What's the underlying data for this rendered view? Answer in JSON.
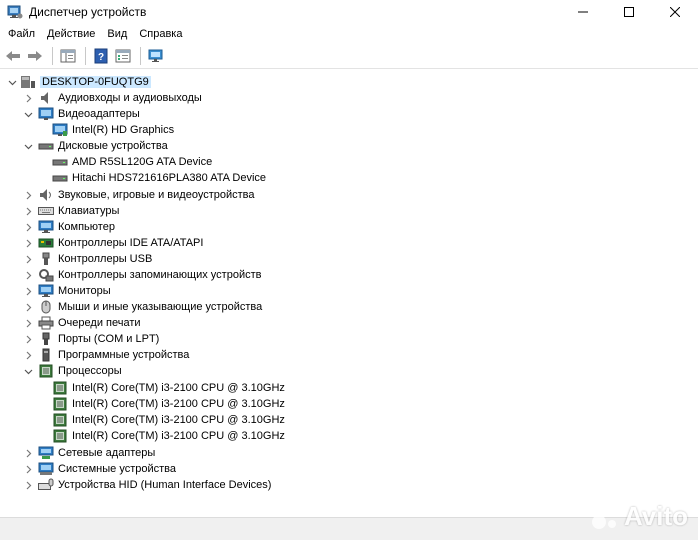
{
  "window": {
    "title": "Диспетчер устройств"
  },
  "menu": {
    "file": "Файл",
    "action": "Действие",
    "view": "Вид",
    "help": "Справка"
  },
  "tree": {
    "root": "DESKTOP-0FUQTG9",
    "audio_io": "Аудиовходы и аудиовыходы",
    "video": "Видеоадаптеры",
    "video_child": "Intel(R) HD Graphics",
    "disks": "Дисковые устройства",
    "disk1": "AMD R5SL120G ATA Device",
    "disk2": "Hitachi HDS721616PLA380 ATA Device",
    "sound": "Звуковые, игровые и видеоустройства",
    "keyboards": "Клавиатуры",
    "computer": "Компьютер",
    "ide": "Контроллеры IDE ATA/ATAPI",
    "usb": "Контроллеры USB",
    "storage": "Контроллеры запоминающих устройств",
    "monitors": "Мониторы",
    "mice": "Мыши и иные указывающие устройства",
    "print_queue": "Очереди печати",
    "ports": "Порты (COM и LPT)",
    "software": "Программные устройства",
    "cpus": "Процессоры",
    "cpu1": "Intel(R) Core(TM) i3-2100 CPU @ 3.10GHz",
    "cpu2": "Intel(R) Core(TM) i3-2100 CPU @ 3.10GHz",
    "cpu3": "Intel(R) Core(TM) i3-2100 CPU @ 3.10GHz",
    "cpu4": "Intel(R) Core(TM) i3-2100 CPU @ 3.10GHz",
    "network": "Сетевые адаптеры",
    "system": "Системные устройства",
    "hid": "Устройства HID (Human Interface Devices)"
  },
  "watermark": {
    "text": "Avito"
  },
  "colors": {
    "selection": "#cce8ff",
    "status_bar": "#f0f0f0",
    "chevron": "#7a7a7a"
  }
}
